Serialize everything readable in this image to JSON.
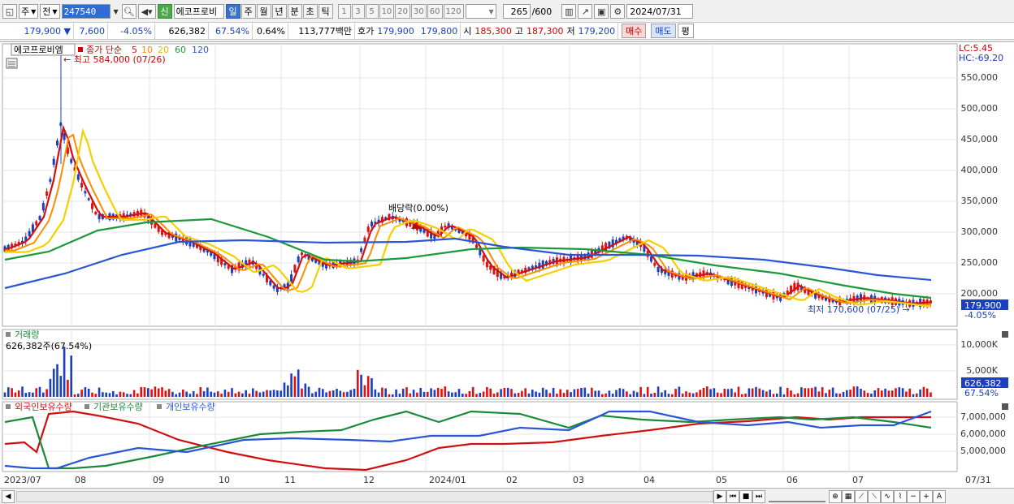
{
  "toolbar": {
    "period_label": "주",
    "prev_label": "전",
    "code": "247540",
    "badge": "신",
    "name": "에코프로비",
    "tabs": [
      {
        "label": "일",
        "active": true
      },
      {
        "label": "주",
        "active": false
      },
      {
        "label": "월",
        "active": false
      },
      {
        "label": "년",
        "active": false
      },
      {
        "label": "분",
        "active": false
      },
      {
        "label": "초",
        "active": false
      },
      {
        "label": "틱",
        "active": false
      }
    ],
    "numbers": [
      "1",
      "3",
      "5",
      "10",
      "20",
      "30",
      "60",
      "120"
    ],
    "count": "265",
    "count_max": "/600",
    "date": "2024/07/31"
  },
  "quote": {
    "price": "179,900",
    "change": "7,600",
    "change_pct": "-4.05%",
    "volume": "626,382",
    "vol_ratio": "67.54%",
    "turnover": "0.64%",
    "amount": "113,777백만",
    "hoga_label": "호가",
    "bid1": "179,900",
    "bid2": "179,800",
    "open_label": "시",
    "open": "185,300",
    "high_label": "고",
    "high": "187,300",
    "low_label": "저",
    "low": "179,200",
    "buy_label": "매수",
    "sell_label": "매도",
    "avg_label": "평"
  },
  "chart": {
    "legend_name": "에코프로비엠",
    "legend_ma": "종가 단순",
    "ma_periods": [
      "5",
      "10",
      "20",
      "60",
      "120"
    ],
    "ma_colors": [
      "#d01010",
      "#ff8c00",
      "#f5d000",
      "#1a9a3a",
      "#2a56d6"
    ],
    "high_note": "최고 584,000 (07/26)",
    "low_note": "최저 170,600 (07/25)",
    "dividend_note": "배당락(0.00%)",
    "lc_label": "LC:5.45",
    "hc_label": "HC:-69.20",
    "price_axis": [
      "550,000",
      "500,000",
      "450,000",
      "400,000",
      "350,000",
      "300,000",
      "250,000",
      "200,000"
    ],
    "last_price": "179,900",
    "last_change": "-4.05%",
    "volume_title": "거래량",
    "volume_note": "626,382주(67.54%)",
    "volume_axis": [
      "10,000K",
      "5,000K"
    ],
    "volume_last": "626,382",
    "volume_pct": "67.54%",
    "holdings_legend": [
      "외국인보유수량",
      "기관보유수량",
      "개인보유수량"
    ],
    "holdings_colors": [
      "#d01010",
      "#1a8a3a",
      "#2a56d6"
    ],
    "holdings_axis": [
      "7,000,000",
      "6,000,000",
      "5,000,000"
    ],
    "x_labels": [
      "2023/07",
      "08",
      "09",
      "10",
      "11",
      "12",
      "2024/01",
      "02",
      "03",
      "04",
      "05",
      "06",
      "07",
      "07/31"
    ]
  }
}
